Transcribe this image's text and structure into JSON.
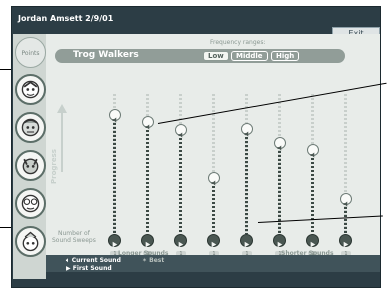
{
  "header": {
    "user_date": "Jordan Amsett   2/9/01",
    "exit_label": "Exit"
  },
  "left_panel": {
    "points_label": "Points",
    "players": [
      {
        "name": "player-1"
      },
      {
        "name": "player-2"
      },
      {
        "name": "player-3"
      },
      {
        "name": "player-4"
      },
      {
        "name": "player-5"
      }
    ]
  },
  "game": {
    "title": "Trog Walkers",
    "frequency_label": "Frequency ranges:",
    "ranges": [
      "Low",
      "Middle",
      "High"
    ],
    "selected_range": "Low"
  },
  "chart": {
    "progress_label": "Progress",
    "sweeps_label_line1": "Number of",
    "sweeps_label_line2": "Sound Sweeps",
    "longer_label": "Longer Sounds",
    "shorter_label": "Shorter Sounds",
    "columns": [
      {
        "level": 0.85,
        "sweeps": "1"
      },
      {
        "level": 0.8,
        "sweeps": "1"
      },
      {
        "level": 0.74,
        "sweeps": "1"
      },
      {
        "level": 0.4,
        "sweeps": "1"
      },
      {
        "level": 0.75,
        "sweeps": "1"
      },
      {
        "level": 0.65,
        "sweeps": "1"
      },
      {
        "level": 0.6,
        "sweeps": "1"
      },
      {
        "level": 0.25,
        "sweeps": "1"
      }
    ]
  },
  "legend": {
    "current_sound": "Current Sound",
    "best": "Best",
    "first_sound": "First Sound"
  },
  "colors": {
    "frame": "#2c3d45",
    "panel": "#e8ece9",
    "title_bar": "#919d98"
  }
}
